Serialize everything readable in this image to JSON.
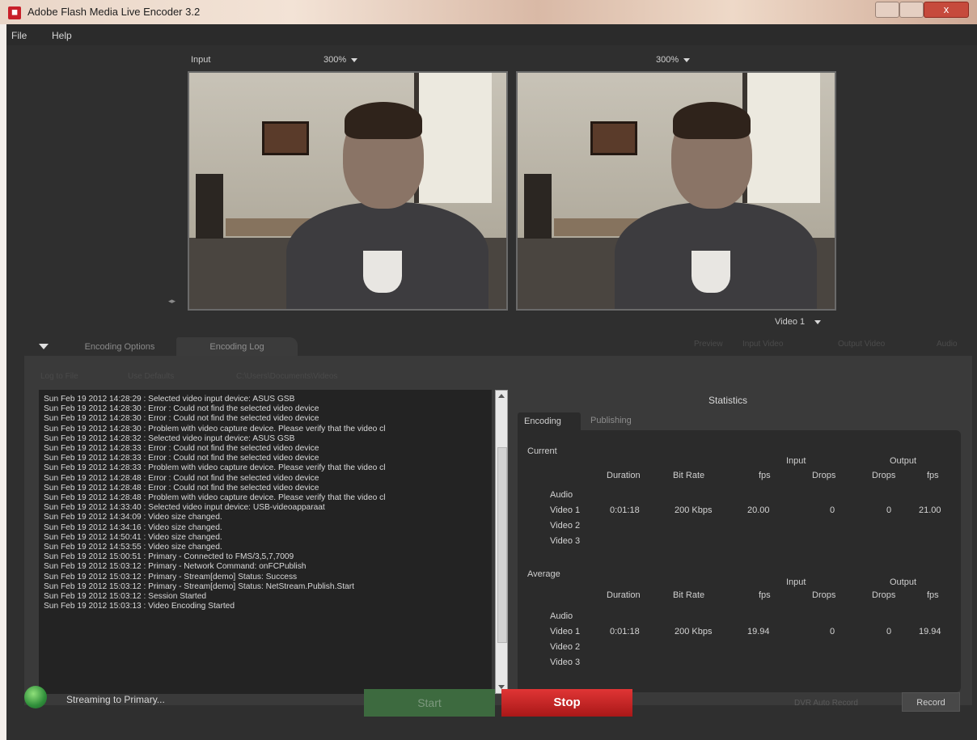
{
  "window": {
    "title": "Adobe Flash Media Live Encoder 3.2",
    "app_icon": "fmle-icon",
    "close_glyph": "x"
  },
  "menu": {
    "items": [
      "File",
      "Help"
    ]
  },
  "preview": {
    "input_label": "Input",
    "input_zoom": "300%",
    "output_zoom": "300%",
    "video_source": "Video 1"
  },
  "tabs": {
    "encoding_options": "Encoding Options",
    "encoding_log": "Encoding Log",
    "right_toggles": [
      "Preview",
      "Input Video",
      "Output Video",
      "Audio"
    ]
  },
  "log_toolbar": {
    "items": [
      "Log to File",
      "Use Defaults",
      "C:\\Users\\Documents\\Videos"
    ]
  },
  "log": {
    "lines": [
      "Sun Feb 19 2012 14:28:29 : Selected video input device: ASUS GSB",
      "Sun Feb 19 2012 14:28:30 : Error : Could not find the selected video device",
      "Sun Feb 19 2012 14:28:30 : Error : Could not find the selected video device",
      "Sun Feb 19 2012 14:28:30 : Problem with video capture device. Please verify that the video cl",
      "Sun Feb 19 2012 14:28:32 : Selected video input device: ASUS GSB",
      "Sun Feb 19 2012 14:28:33 : Error : Could not find the selected video device",
      "Sun Feb 19 2012 14:28:33 : Error : Could not find the selected video device",
      "Sun Feb 19 2012 14:28:33 : Problem with video capture device. Please verify that the video cl",
      "Sun Feb 19 2012 14:28:48 : Error : Could not find the selected video device",
      "Sun Feb 19 2012 14:28:48 : Error : Could not find the selected video device",
      "Sun Feb 19 2012 14:28:48 : Problem with video capture device. Please verify that the video cl",
      "Sun Feb 19 2012 14:33:40 : Selected video input device: USB-videoapparaat",
      "Sun Feb 19 2012 14:34:09 : Video size changed.",
      "Sun Feb 19 2012 14:34:16 : Video size changed.",
      "Sun Feb 19 2012 14:50:41 : Video size changed.",
      "Sun Feb 19 2012 14:53:55 : Video size changed.",
      "Sun Feb 19 2012 15:00:51 : Primary - Connected to FMS/3,5,7,7009",
      "Sun Feb 19 2012 15:03:12 : Primary - Network Command: onFCPublish",
      "Sun Feb 19 2012 15:03:12 : Primary - Stream[demo] Status: Success",
      "Sun Feb 19 2012 15:03:12 : Primary - Stream[demo] Status: NetStream.Publish.Start",
      "Sun Feb 19 2012 15:03:12 : Session Started",
      "Sun Feb 19 2012 15:03:13 : Video Encoding Started"
    ]
  },
  "stats": {
    "title": "Statistics",
    "tab_encoding": "Encoding",
    "tab_publishing": "Publishing",
    "current_label": "Current",
    "average_label": "Average",
    "group_input": "Input",
    "group_output": "Output",
    "col_duration": "Duration",
    "col_bitrate": "Bit Rate",
    "col_fps_in": "fps",
    "col_drops_in": "Drops",
    "col_drops_out": "Drops",
    "col_fps_out": "fps",
    "rows": [
      "Audio",
      "Video 1",
      "Video 2",
      "Video 3"
    ],
    "current_video1": {
      "duration": "0:01:18",
      "bitrate": "200 Kbps",
      "fps_in": "20.00",
      "drops_in": "0",
      "drops_out": "0",
      "fps_out": "21.00"
    },
    "average_video1": {
      "duration": "0:01:18",
      "bitrate": "200 Kbps",
      "fps_in": "19.94",
      "drops_in": "0",
      "drops_out": "0",
      "fps_out": "19.94"
    }
  },
  "statusbar": {
    "status_text": "Streaming to Primary...",
    "start_label": "Start",
    "stop_label": "Stop",
    "auto_record_label": "DVR Auto Record",
    "record_label": "Record"
  },
  "colors": {
    "stop_red": "#cf2222",
    "start_green": "#3d6a3f",
    "app_bg": "#2f2f2f"
  }
}
